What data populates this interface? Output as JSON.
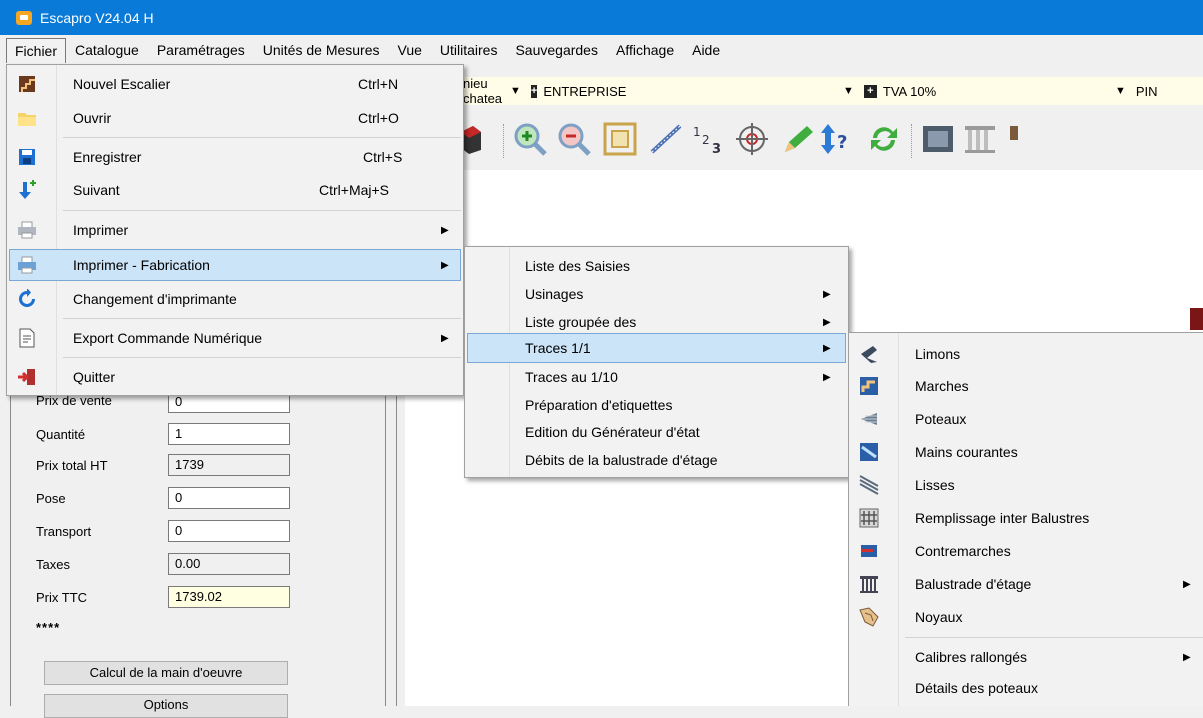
{
  "window": {
    "title": "Escapro V24.04 H"
  },
  "menubar": [
    "Fichier",
    "Catalogue",
    "Paramétrages",
    "Unités de Mesures",
    "Vue",
    "Utilitaires",
    "Sauvegardes",
    "Affichage",
    "Aide"
  ],
  "combos": {
    "site": "nieu chatea",
    "client_type": "ENTREPRISE",
    "tva": "TVA 10%",
    "wood": "PIN"
  },
  "left_panel": {
    "prix_vente_label": "Prix de vente",
    "prix_vente_value": "0",
    "quantite_label": "Quantité",
    "quantite_value": "1",
    "prix_total_label": "Prix total HT",
    "prix_total_value": "1739",
    "pose_label": "Pose",
    "pose_value": "0",
    "transport_label": "Transport",
    "transport_value": "0",
    "taxes_label": "Taxes",
    "taxes_value": "0.00",
    "ttc_label": "Prix TTC",
    "ttc_value": "1739.02",
    "stars": "****",
    "calc_button": "Calcul de la main d'oeuvre",
    "options_button": "Options"
  },
  "fichier_menu": [
    {
      "label": "Nouvel Escalier",
      "shortcut": "Ctrl+N",
      "icon": "staircase-icon"
    },
    {
      "label": "Ouvrir",
      "shortcut": "Ctrl+O",
      "icon": "folder-icon"
    },
    {
      "label": "Enregistrer",
      "shortcut": "Ctrl+S",
      "icon": "floppy-icon"
    },
    {
      "label": "Suivant",
      "shortcut": "Ctrl+Maj+S",
      "icon": "arrow-down-plus-icon"
    },
    {
      "label": "Imprimer",
      "shortcut": "",
      "icon": "printer-icon"
    },
    {
      "label": "Imprimer - Fabrication",
      "shortcut": "",
      "icon": "printer-blue-icon"
    },
    {
      "label": "Changement d'imprimante",
      "shortcut": "",
      "icon": "refresh-icon"
    },
    {
      "label": "Export Commande Numérique",
      "shortcut": "",
      "icon": "document-export-icon"
    },
    {
      "label": "Quitter",
      "shortcut": "",
      "icon": "exit-door-icon"
    }
  ],
  "fabrication_menu": [
    "Liste des Saisies",
    "Usinages",
    "Liste groupée des",
    "Traces 1/1",
    "Traces au 1/10",
    "Préparation d'etiquettes",
    "Edition du Générateur d'état",
    "Débits de la balustrade d'étage"
  ],
  "traces_menu": [
    {
      "label": "Limons",
      "icon": "limon-icon"
    },
    {
      "label": "Marches",
      "icon": "marche-icon"
    },
    {
      "label": "Poteaux",
      "icon": "poteau-icon"
    },
    {
      "label": "Mains courantes",
      "icon": "main-courante-icon"
    },
    {
      "label": "Lisses",
      "icon": "lisse-icon"
    },
    {
      "label": "Remplissage inter Balustres",
      "icon": "balustre-fill-icon"
    },
    {
      "label": "Contremarches",
      "icon": "contremarche-icon"
    },
    {
      "label": "Balustrade d'étage",
      "icon": "balustrade-icon"
    },
    {
      "label": "Noyaux",
      "icon": "noyau-icon"
    },
    {
      "label": "Calibres rallongés",
      "icon": ""
    },
    {
      "label": "Détails des poteaux",
      "icon": ""
    }
  ]
}
